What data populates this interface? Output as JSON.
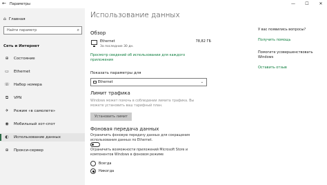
{
  "window": {
    "title": "Параметры",
    "back_glyph": "←",
    "minimize": "—",
    "maximize": "☐",
    "close": "✕"
  },
  "sidebar": {
    "home": "Главная",
    "search_placeholder": "Найти параметр",
    "section": "Сеть и Интернет",
    "items": [
      {
        "label": "Состояние",
        "icon": "globe-icon",
        "glyph": "⊕"
      },
      {
        "label": "Ethernet",
        "icon": "ethernet-icon",
        "glyph": "▭"
      },
      {
        "label": "Набор номера",
        "icon": "dialup-icon",
        "glyph": "☏"
      },
      {
        "label": "VPN",
        "icon": "vpn-icon",
        "glyph": "⧉"
      },
      {
        "label": "Режим «в самолете»",
        "icon": "airplane-icon",
        "glyph": "✈"
      },
      {
        "label": "Мобильный хот-спот",
        "icon": "hotspot-icon",
        "glyph": "◉"
      },
      {
        "label": "Использование данных",
        "icon": "data-usage-icon",
        "glyph": "◐"
      },
      {
        "label": "Прокси-сервер",
        "icon": "proxy-icon",
        "glyph": "⊕"
      }
    ],
    "active_index": 6
  },
  "main": {
    "title": "Использование данных",
    "overview": {
      "heading": "Обзор",
      "network_name": "Ethernet",
      "period": "За последние 30 дн.",
      "amount": "78,82 ГБ",
      "link_line1": "Просмотр сведений об использовании для каждого",
      "link_line2": "приложения"
    },
    "show_params_label": "Показать параметры для",
    "dropdown_value": "Ethernet",
    "traffic_limit": {
      "heading": "Лимит трафика",
      "desc_line1": "Windows может помочь в соблюдении лимита трафика. Вы",
      "desc_line2": "можете установить ваш тарифный план.",
      "button": "Установить лимит"
    },
    "background": {
      "heading": "Фоновая передача данных",
      "desc_line1": "Ограничить фоновую передачу данных для сокращения",
      "desc_line2": "использования данных по Ethernet.",
      "desc2_line1": "Ограничить возможности приложений Microsoft Store и",
      "desc2_line2": "компонентов Windows в фоновом режиме",
      "options": [
        "Всегда",
        "Никогда"
      ],
      "selected": "Никогда"
    }
  },
  "right_panel": {
    "question": "У вас появились вопросы?",
    "help_link": "Получить помощь",
    "improve_line1": "Помогите усовершенствовать",
    "improve_line2": "Windows",
    "feedback_link": "Оставить отзыв"
  },
  "colors": {
    "accent": "#0a7c3b",
    "sidebar_bg": "#f2f2f2",
    "active_bar": "#2b6a45"
  }
}
